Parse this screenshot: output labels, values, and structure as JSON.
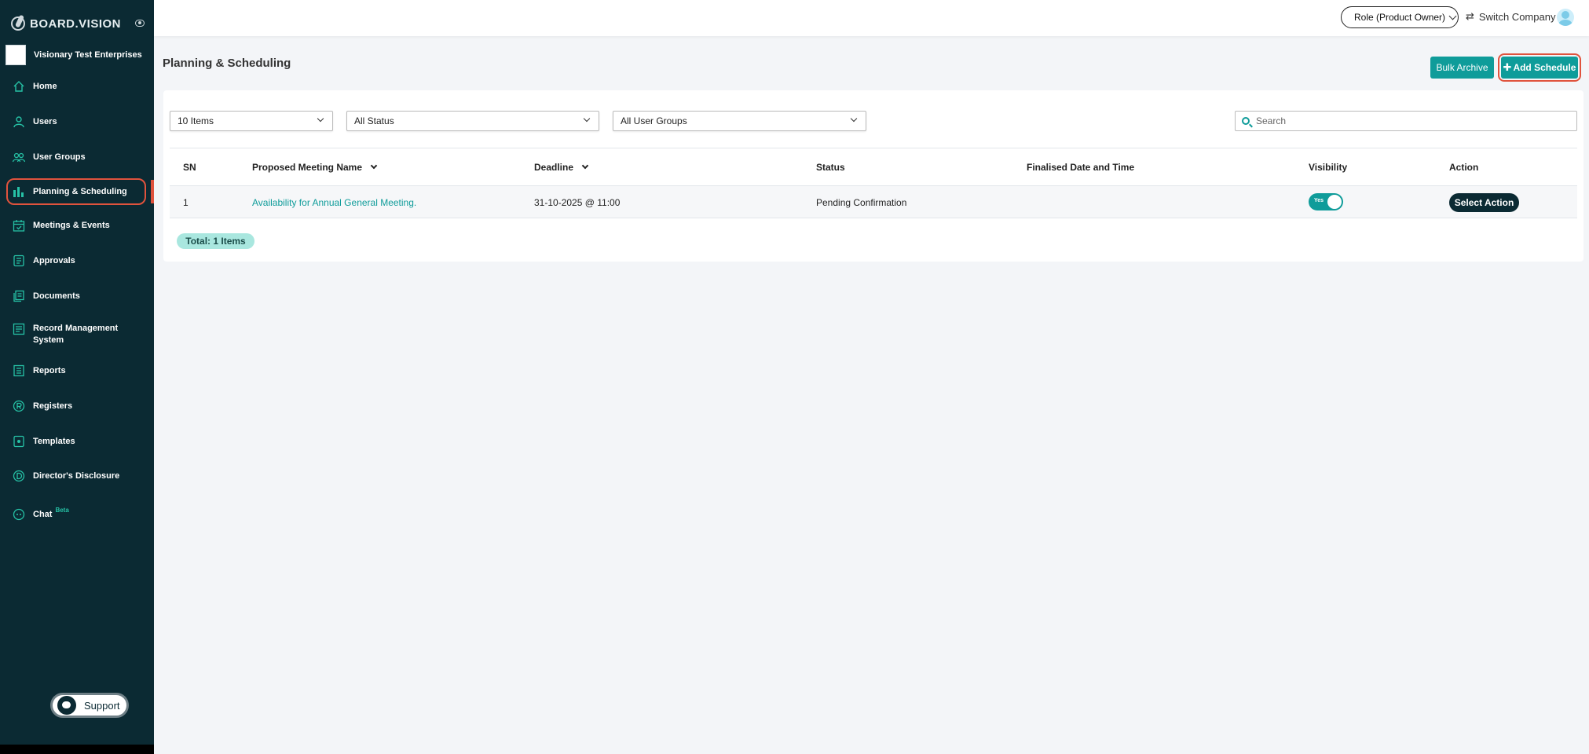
{
  "app": {
    "logo_text": "BOARD.VISION",
    "company_name": "Visionary Test Enterprises"
  },
  "sidebar": {
    "items": [
      {
        "label": "Home",
        "icon": "home-icon"
      },
      {
        "label": "Users",
        "icon": "user-icon"
      },
      {
        "label": "User Groups",
        "icon": "users-icon"
      },
      {
        "label": "Planning & Scheduling",
        "icon": "chart-icon",
        "active": true
      },
      {
        "label": "Meetings & Events",
        "icon": "calendar-icon"
      },
      {
        "label": "Approvals",
        "icon": "approval-icon"
      },
      {
        "label": "Documents",
        "icon": "documents-icon"
      },
      {
        "label": "Record Management",
        "label2": "System",
        "icon": "record-icon"
      },
      {
        "label": "Reports",
        "icon": "report-icon"
      },
      {
        "label": "Registers",
        "icon": "registered-icon"
      },
      {
        "label": "Templates",
        "icon": "template-icon"
      },
      {
        "label": "Director's Disclosure",
        "icon": "disclosure-icon"
      },
      {
        "label": "Chat",
        "icon": "chat-icon",
        "badge": "Beta"
      }
    ],
    "support_label": "Support"
  },
  "topbar": {
    "role_label": "Role (Product Owner)",
    "switch_company_label": "Switch Company"
  },
  "page": {
    "title": "Planning & Scheduling",
    "bulk_archive_label": "Bulk Archive",
    "add_schedule_label": "Add Schedule"
  },
  "filters": {
    "items_per_page": "10 Items",
    "status": "All Status",
    "user_groups": "All User Groups",
    "search_placeholder": "Search"
  },
  "table": {
    "columns": [
      "SN",
      "Proposed Meeting Name",
      "Deadline",
      "Status",
      "Finalised Date and Time",
      "Visibility",
      "Action"
    ],
    "rows": [
      {
        "sn": "1",
        "name": "Availability for Annual General Meeting.",
        "deadline": "31-10-2025 @ 11:00",
        "status": "Pending Confirmation",
        "finalised": "",
        "visibility": "Yes",
        "action": "Select Action"
      }
    ],
    "total_label": "Total: 1 Items"
  },
  "colors": {
    "sidebar_bg": "#0b2a33",
    "accent": "#0f9c9a",
    "highlight": "#e0533d"
  }
}
